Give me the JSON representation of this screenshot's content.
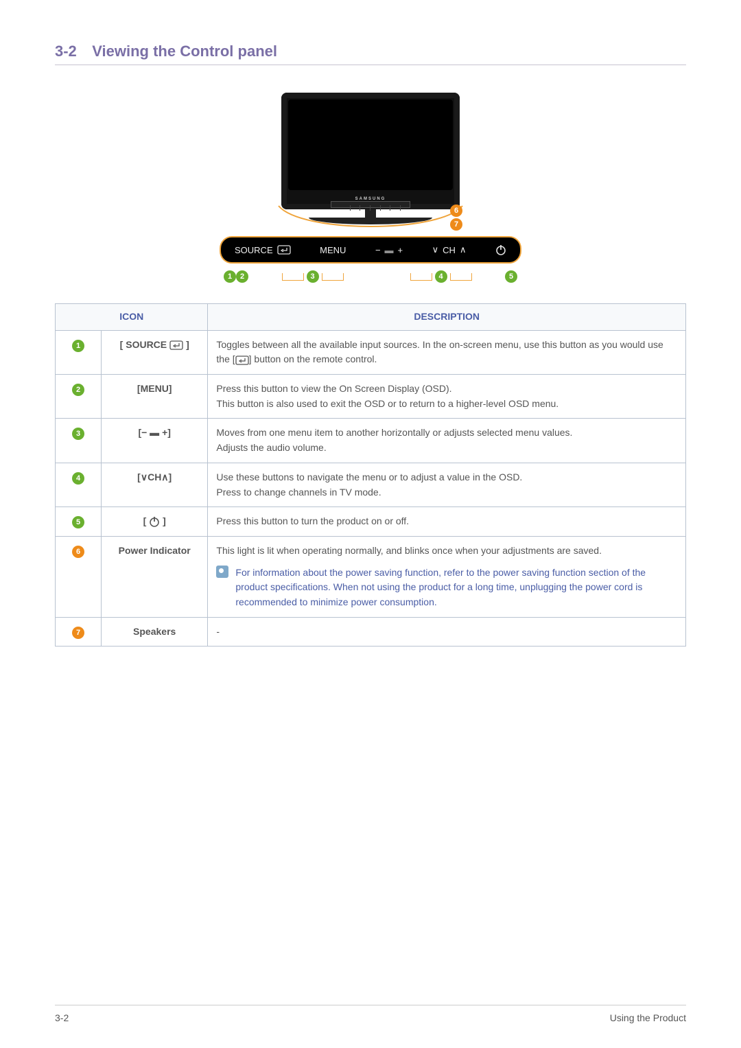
{
  "header": {
    "section_number": "3-2",
    "section_title": "Viewing the Control panel"
  },
  "diagram": {
    "tv_brand": "SAMSUNG",
    "panel_items": {
      "source": "SOURCE",
      "menu": "MENU",
      "minus": "−",
      "vol_icon": "▬",
      "plus": "+",
      "ch_down": "∨",
      "ch_label": "CH",
      "ch_up": "∧"
    },
    "callouts": {
      "c1": "1",
      "c2": "2",
      "c3": "3",
      "c4": "4",
      "c5": "5",
      "c6": "6",
      "c7": "7"
    }
  },
  "table": {
    "head": {
      "icon": "ICON",
      "description": "DESCRIPTION"
    },
    "rows": [
      {
        "num": "1",
        "icon_prefix": "[",
        "icon_text": "SOURCE",
        "icon_suffix": "]",
        "has_enter_glyph": true,
        "desc_lines": [
          "Toggles between all the available input sources. In the on-screen menu, use this button as you would use the [",
          "] button on the remote control."
        ],
        "inline_glyph": true
      },
      {
        "num": "2",
        "icon_text": "[MENU]",
        "desc_lines": [
          "Press this button to view the On Screen Display (OSD).",
          "This button is also used to exit the OSD or to return to a higher-level OSD menu."
        ]
      },
      {
        "num": "3",
        "icon_text": "[− ▬ +]",
        "desc_lines": [
          "Moves from one menu item to another horizontally or adjusts selected menu values.",
          "Adjusts the audio volume."
        ]
      },
      {
        "num": "4",
        "icon_text": "[∨CH∧]",
        "desc_lines": [
          "Use these buttons to navigate the menu or to adjust a value in the OSD.",
          "Press to change channels in TV mode."
        ]
      },
      {
        "num": "5",
        "icon_text": "",
        "power_glyph": true,
        "desc_lines": [
          "Press this button to turn the product on or off."
        ]
      },
      {
        "num": "6",
        "icon_text": "Power Indicator",
        "desc_lines": [
          "This light is lit when operating normally, and blinks once when your adjustments are saved."
        ],
        "note": "For information about the power saving function, refer to the power saving function section of the product specifications. When not using the product for a long time, unplugging the power cord is recommended to minimize power consumption."
      },
      {
        "num": "7",
        "icon_text": "Speakers",
        "desc_lines": [
          "-"
        ]
      }
    ]
  },
  "footer": {
    "left": "3-2",
    "right": "Using the Product"
  }
}
